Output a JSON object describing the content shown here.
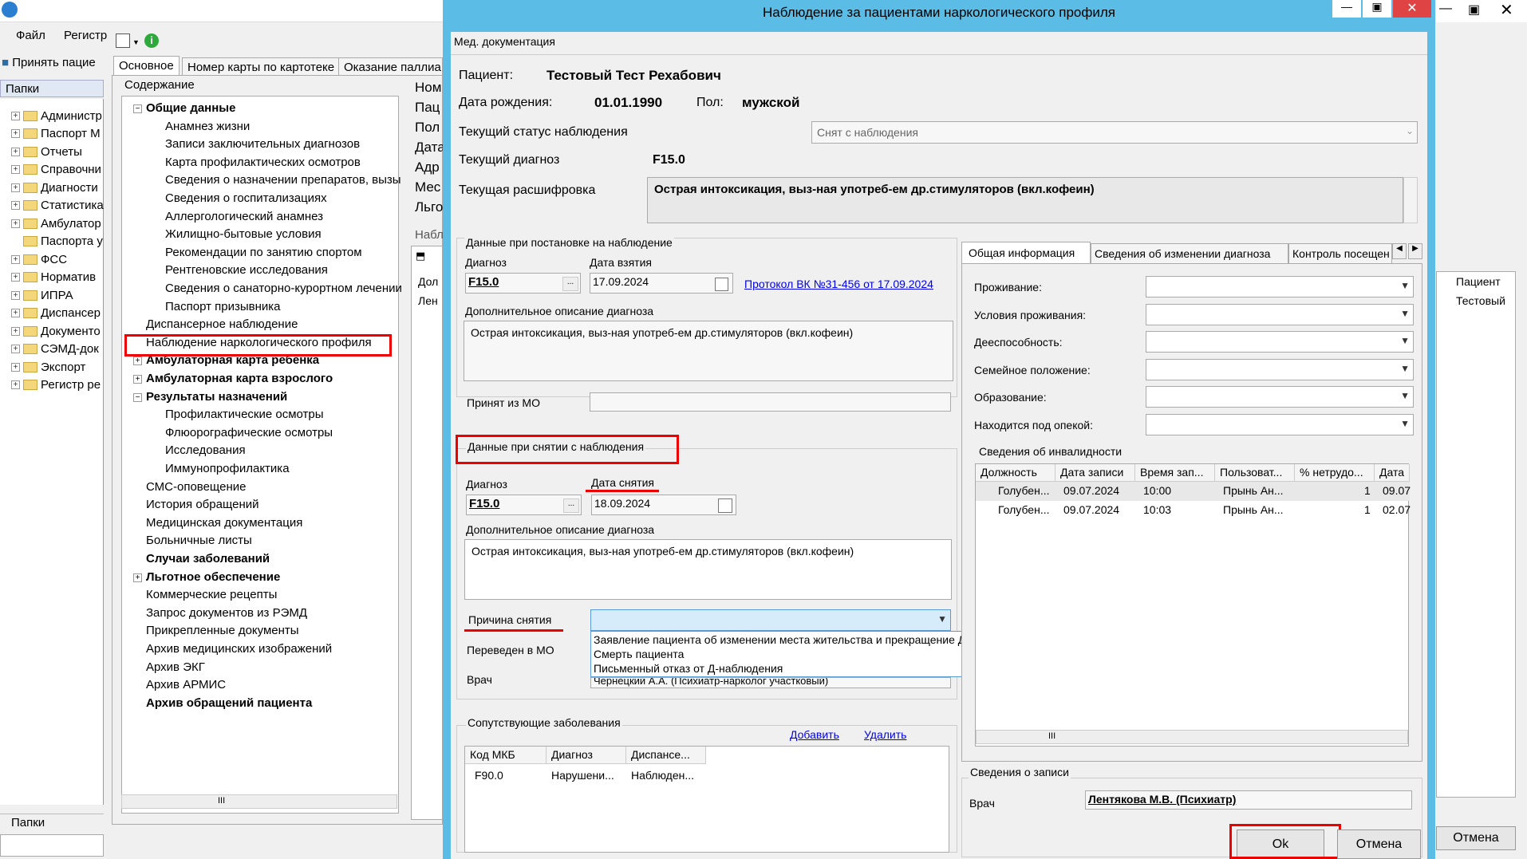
{
  "main_window": {
    "menu": [
      "Файл",
      "Регистр"
    ],
    "toolbar_accept": "Принять пацие",
    "folders_header": "Папки",
    "folders_footer": "Папки",
    "folders": [
      "Администр",
      "Паспорт М",
      "Отчеты",
      "Справочни",
      "Диагности",
      "Статистика",
      "Амбулатор",
      "Паспорта у",
      "ФСС",
      "Норматив",
      "ИПРА",
      "Диспансер",
      "Документо",
      "СЭМД-док",
      "Экспорт",
      "Регистр ре"
    ],
    "tabs": [
      "Основное",
      "Номер карты по картотеке",
      "Оказание паллиа"
    ],
    "content_header": "Содержание",
    "tree": [
      {
        "label": "Общие данные",
        "bold": true,
        "level": 0
      },
      {
        "label": "Анамнез жизни",
        "level": 1
      },
      {
        "label": "Записи заключительных диагнозов",
        "level": 1
      },
      {
        "label": "Карта профилактических осмотров",
        "level": 1
      },
      {
        "label": "Сведения о назначении препаратов, вызы",
        "level": 1
      },
      {
        "label": "Сведения о госпитализациях",
        "level": 1
      },
      {
        "label": "Аллергологический анамнез",
        "level": 1
      },
      {
        "label": "Жилищно-бытовые условия",
        "level": 1
      },
      {
        "label": "Рекомендации по занятию спортом",
        "level": 1
      },
      {
        "label": "Рентгеновские исследования",
        "level": 1
      },
      {
        "label": "Сведения о санаторно-курортном лечении",
        "level": 1
      },
      {
        "label": "Паспорт призывника",
        "level": 1
      },
      {
        "label": "Диспансерное наблюдение",
        "level": 0
      },
      {
        "label": "Наблюдение наркологического профиля",
        "level": 0
      },
      {
        "label": "Амбулаторная карта ребенка",
        "bold": true,
        "level": 0
      },
      {
        "label": "Амбулаторная карта взрослого",
        "bold": true,
        "level": 0
      },
      {
        "label": "Результаты назначений",
        "bold": true,
        "level": 0
      },
      {
        "label": "Профилактические осмотры",
        "level": 1
      },
      {
        "label": "Флюорографические осмотры",
        "level": 1
      },
      {
        "label": "Исследования",
        "level": 1
      },
      {
        "label": "Иммунопрофилактика",
        "level": 1
      },
      {
        "label": "СМС-оповещение",
        "level": 0
      },
      {
        "label": "История обращений",
        "level": 0
      },
      {
        "label": "Медицинская документация",
        "level": 0
      },
      {
        "label": "Больничные листы",
        "level": 0
      },
      {
        "label": "Случаи заболеваний",
        "bold": true,
        "level": 0
      },
      {
        "label": "Льготное обеспечение",
        "bold": true,
        "level": 0
      },
      {
        "label": "Коммерческие рецепты",
        "level": 0
      },
      {
        "label": "Запрос документов из РЭМД",
        "level": 0
      },
      {
        "label": "Прикрепленные документы",
        "level": 0
      },
      {
        "label": "Архив медицинских изображений",
        "level": 0
      },
      {
        "label": "Архив ЭКГ",
        "level": 0
      },
      {
        "label": "Архив АРМИС",
        "level": 0
      },
      {
        "label": "Архив обращений пациента",
        "bold": true,
        "level": 0
      }
    ],
    "side_labels": [
      "Ном",
      "Пац",
      "Пол",
      "Дата",
      "Адр",
      "Мес",
      "Льго"
    ],
    "side_sub": "Набл",
    "side_cols": [
      "Дол",
      "Лен"
    ],
    "right_header": "Пациент",
    "right_value": "Тестовый",
    "close_btn": "Отмена",
    "scroll_mark": "III"
  },
  "dialog": {
    "title": "Наблюдение за пациентами наркологического профиля",
    "section": "Мед. документация",
    "patient_label": "Пациент:",
    "patient": "Тестовый Тест Рехабович",
    "dob_label": "Дата рождения:",
    "dob": "01.01.1990",
    "sex_label": "Пол:",
    "sex": "мужской",
    "status_label": "Текущий статус наблюдения",
    "status": "Снят с наблюдения",
    "diag_label": "Текущий диагноз",
    "diag": "F15.0",
    "decode_label": "Текущая расшифровка",
    "decode": "Острая интоксикация, выз-ная употреб-ем др.стимуляторов (вкл.кофеин)",
    "reg": {
      "title": "Данные при постановке на наблюдение",
      "diag_label": "Диагноз",
      "diag": "F15.0",
      "date_label": "Дата взятия",
      "date": "17.09.2024",
      "protocol": "Протокол ВК №31-456 от 17.09.2024",
      "desc_label": "Дополнительное описание диагноза",
      "desc": "Острая интоксикация, выз-ная употреб-ем др.стимуляторов (вкл.кофеин)",
      "from_mo_label": "Принят из МО"
    },
    "rem": {
      "title": "Данные при снятии с наблюдения",
      "diag_label": "Диагноз",
      "diag": "F15.0",
      "date_label": "Дата снятия",
      "date": "18.09.2024",
      "desc_label": "Дополнительное описание диагноза",
      "desc": "Острая интоксикация, выз-ная употреб-ем др.стимуляторов (вкл.кофеин)",
      "reason_label": "Причина снятия",
      "reason_options": [
        "Заявление пациента об изменении места жительства и прекращение Д-наблюдения в МО",
        "Смерть пациента",
        "Письменный отказ от Д-наблюдения"
      ],
      "moved_label": "Переведен в МО",
      "doctor_label": "Врач",
      "doctor": "Чернецкий А.А. (Психиатр-нарколог участковый)"
    },
    "comorb": {
      "title": "Сопутствующие заболевания",
      "add": "Добавить",
      "delete": "Удалить",
      "columns": [
        "Код МКБ",
        "Диагноз",
        "Диспансе..."
      ],
      "rows": [
        [
          "F90.0",
          "Нарушени...",
          "Наблюден..."
        ]
      ]
    },
    "right_tabs": [
      "Общая информация",
      "Сведения об изменении диагноза",
      "Контроль посещен"
    ],
    "info_fields": [
      "Проживание:",
      "Условия проживания:",
      "Дееспособность:",
      "Семейное положение:",
      "Образование:",
      "Находится под опекой:"
    ],
    "disability": {
      "title": "Сведения об инвалидности",
      "columns": [
        "Должность",
        "Дата записи",
        "Время зап...",
        "Пользоват...",
        "% нетрудо...",
        "Дата"
      ],
      "rows": [
        [
          "Голубен...",
          "09.07.2024",
          "10:00",
          "Прынь Ан...",
          "1",
          "09.07"
        ],
        [
          "Голубен...",
          "09.07.2024",
          "10:03",
          "Прынь Ан...",
          "1",
          "02.07"
        ]
      ]
    },
    "record": {
      "title": "Сведения о записи",
      "doctor_label": "Врач",
      "doctor": "Лентякова М.В. (Психиатр)"
    },
    "ok": "Ok",
    "cancel": "Отмена",
    "scroll_mark": "III"
  },
  "colors": {
    "title_bar": "#5bbde6",
    "highlight": "#e00000",
    "link": "#0000ee",
    "dropdown_selected": "#d6ecfa"
  }
}
